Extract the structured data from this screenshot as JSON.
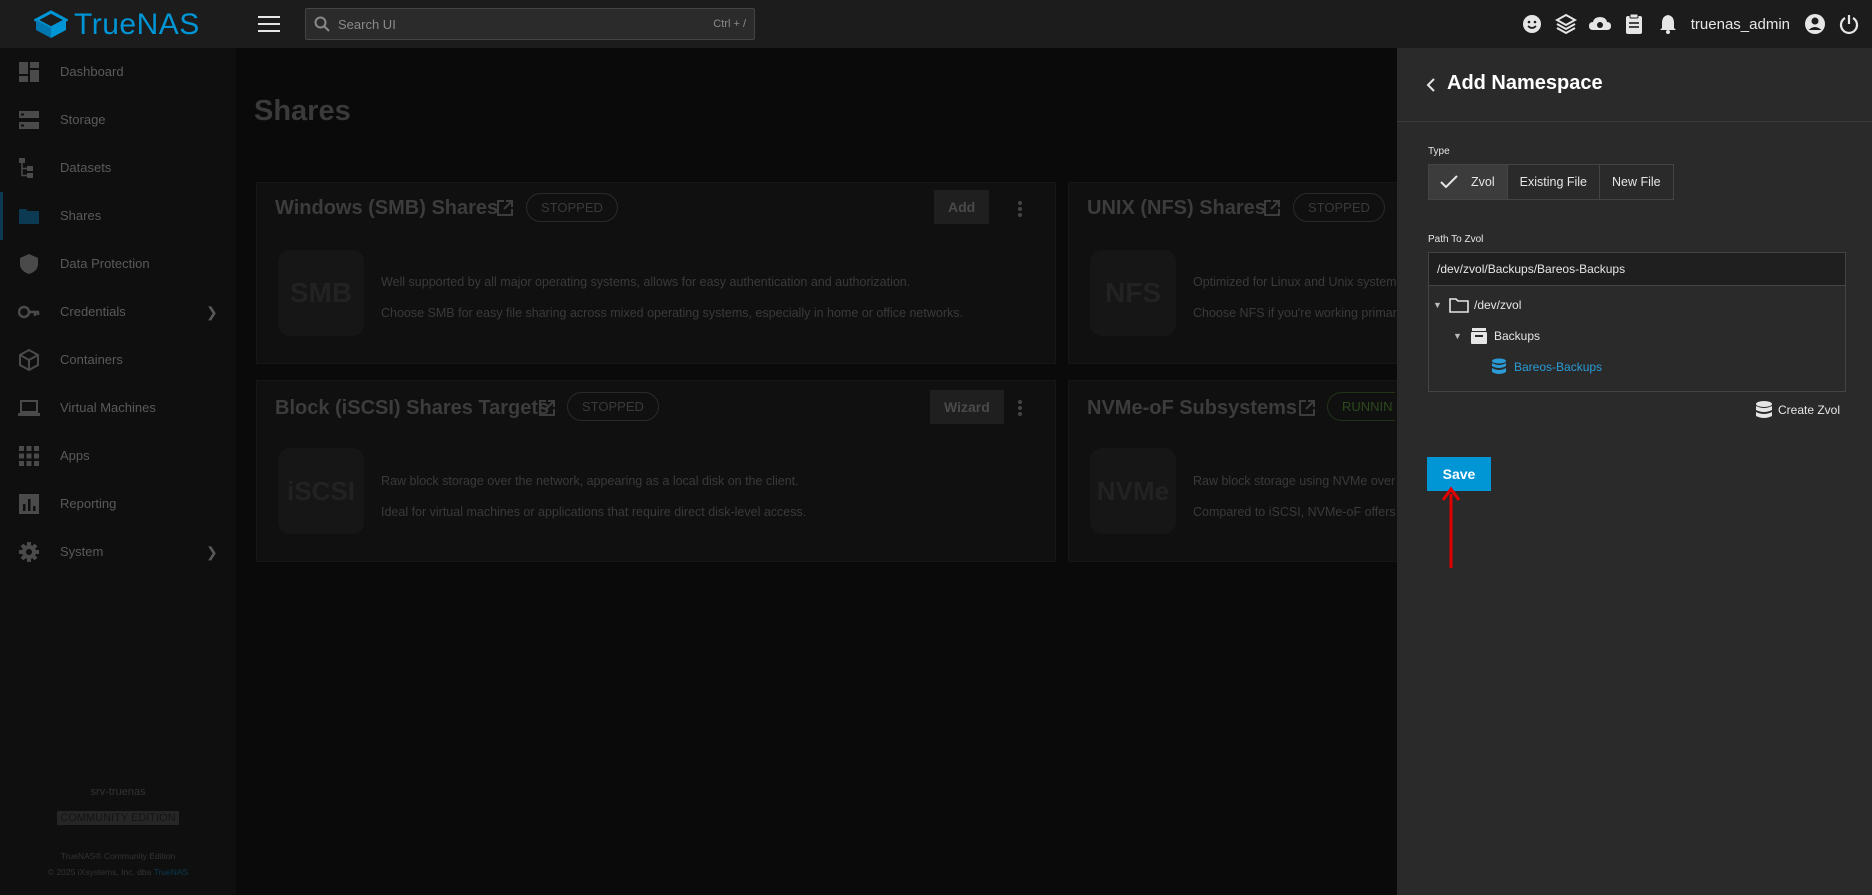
{
  "topbar": {
    "app_name": "TrueNAS",
    "search_placeholder": "Search UI",
    "search_shortcut": "Ctrl + /",
    "username": "truenas_admin",
    "icons": [
      "feedback-icon",
      "truecommand-icon",
      "directory-services-icon",
      "jobs-icon",
      "notifications-icon",
      "account-icon",
      "power-icon"
    ]
  },
  "sidebar": {
    "items": [
      {
        "label": "Dashboard",
        "icon": "dashboard-icon"
      },
      {
        "label": "Storage",
        "icon": "storage-icon"
      },
      {
        "label": "Datasets",
        "icon": "datasets-icon"
      },
      {
        "label": "Shares",
        "icon": "shares-icon",
        "active": true
      },
      {
        "label": "Data Protection",
        "icon": "shield-icon"
      },
      {
        "label": "Credentials",
        "icon": "key-icon",
        "expandable": true
      },
      {
        "label": "Containers",
        "icon": "containers-icon"
      },
      {
        "label": "Virtual Machines",
        "icon": "laptop-icon"
      },
      {
        "label": "Apps",
        "icon": "apps-grid-icon"
      },
      {
        "label": "Reporting",
        "icon": "reporting-icon"
      },
      {
        "label": "System",
        "icon": "gear-icon",
        "expandable": true
      }
    ],
    "hostname": "srv-truenas",
    "edition": "COMMUNITY EDITION",
    "copyright_1": "TrueNAS® Community Edition",
    "copyright_2": "© 2025 iXsystems, Inc. dba",
    "copyright_link": "TrueNAS"
  },
  "main": {
    "title": "Shares",
    "cards": {
      "smb": {
        "title": "Windows (SMB) Shares",
        "status": "STOPPED",
        "action": "Add",
        "icon_text": "SMB",
        "line1": "Well supported by all major operating systems, allows for easy authentication and authorization.",
        "line2": "Choose SMB for easy file sharing across mixed operating systems, especially in home or office networks."
      },
      "nfs": {
        "title": "UNIX (NFS) Shares",
        "status": "STOPPED",
        "icon_text": "NFS",
        "line1": "Optimized for Linux and Unix systems",
        "line2": "Choose NFS if you're working primari"
      },
      "iscsi": {
        "title": "Block (iSCSI) Shares Targets",
        "status": "STOPPED",
        "action": "Wizard",
        "icon_text": "iSCSI",
        "line1": "Raw block storage over the network, appearing as a local disk on the client.",
        "line2": "Ideal for virtual machines or applications that require direct disk-level access."
      },
      "nvme": {
        "title": "NVMe-oF Subsystems",
        "status": "RUNNIN",
        "icon_text": "NVMe",
        "line1": "Raw block storage using NVMe over F",
        "line2": "Compared to iSCSI, NVMe-oF offers s"
      }
    }
  },
  "panel": {
    "title": "Add Namespace",
    "type_label": "Type",
    "type_options": [
      "Zvol",
      "Existing File",
      "New File"
    ],
    "type_selected": "Zvol",
    "path_label": "Path To Zvol",
    "path_value": "/dev/zvol/Backups/Bareos-Backups",
    "tree": {
      "root": "/dev/zvol",
      "child": "Backups",
      "leaf": "Bareos-Backups"
    },
    "create_zvol": "Create Zvol",
    "save": "Save"
  },
  "colors": {
    "accent": "#0095d5",
    "annotation_arrow": "#e00000"
  }
}
